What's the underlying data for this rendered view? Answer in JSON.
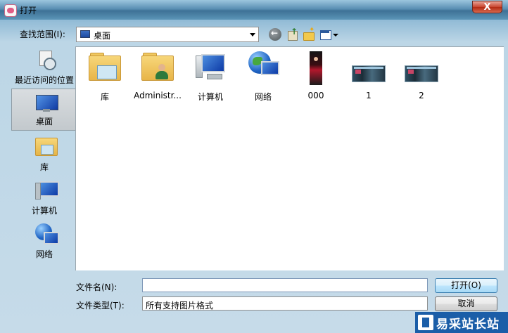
{
  "window": {
    "title": "打开",
    "close_label": "X"
  },
  "lookin": {
    "label": "查找范围(I):",
    "value": "桌面"
  },
  "places": [
    {
      "label": "最近访问的位置"
    },
    {
      "label": "桌面"
    },
    {
      "label": "库"
    },
    {
      "label": "计算机"
    },
    {
      "label": "网络"
    }
  ],
  "files": [
    {
      "name": "库",
      "icon": "library-folder-icon"
    },
    {
      "name": "Administr...",
      "icon": "user-folder-icon"
    },
    {
      "name": "计算机",
      "icon": "computer-icon"
    },
    {
      "name": "网络",
      "icon": "network-icon"
    },
    {
      "name": "000",
      "icon": "photo-thumbnail-icon"
    },
    {
      "name": "1",
      "icon": "screenshot-thumbnail-icon"
    },
    {
      "name": "2",
      "icon": "screenshot-thumbnail-icon"
    }
  ],
  "filename": {
    "label": "文件名(N):",
    "value": ""
  },
  "filetype": {
    "label": "文件类型(T):",
    "value": "所有支持图片格式"
  },
  "buttons": {
    "open": "打开(O)",
    "cancel": "取消"
  },
  "watermark": {
    "text": "易采站长站"
  }
}
